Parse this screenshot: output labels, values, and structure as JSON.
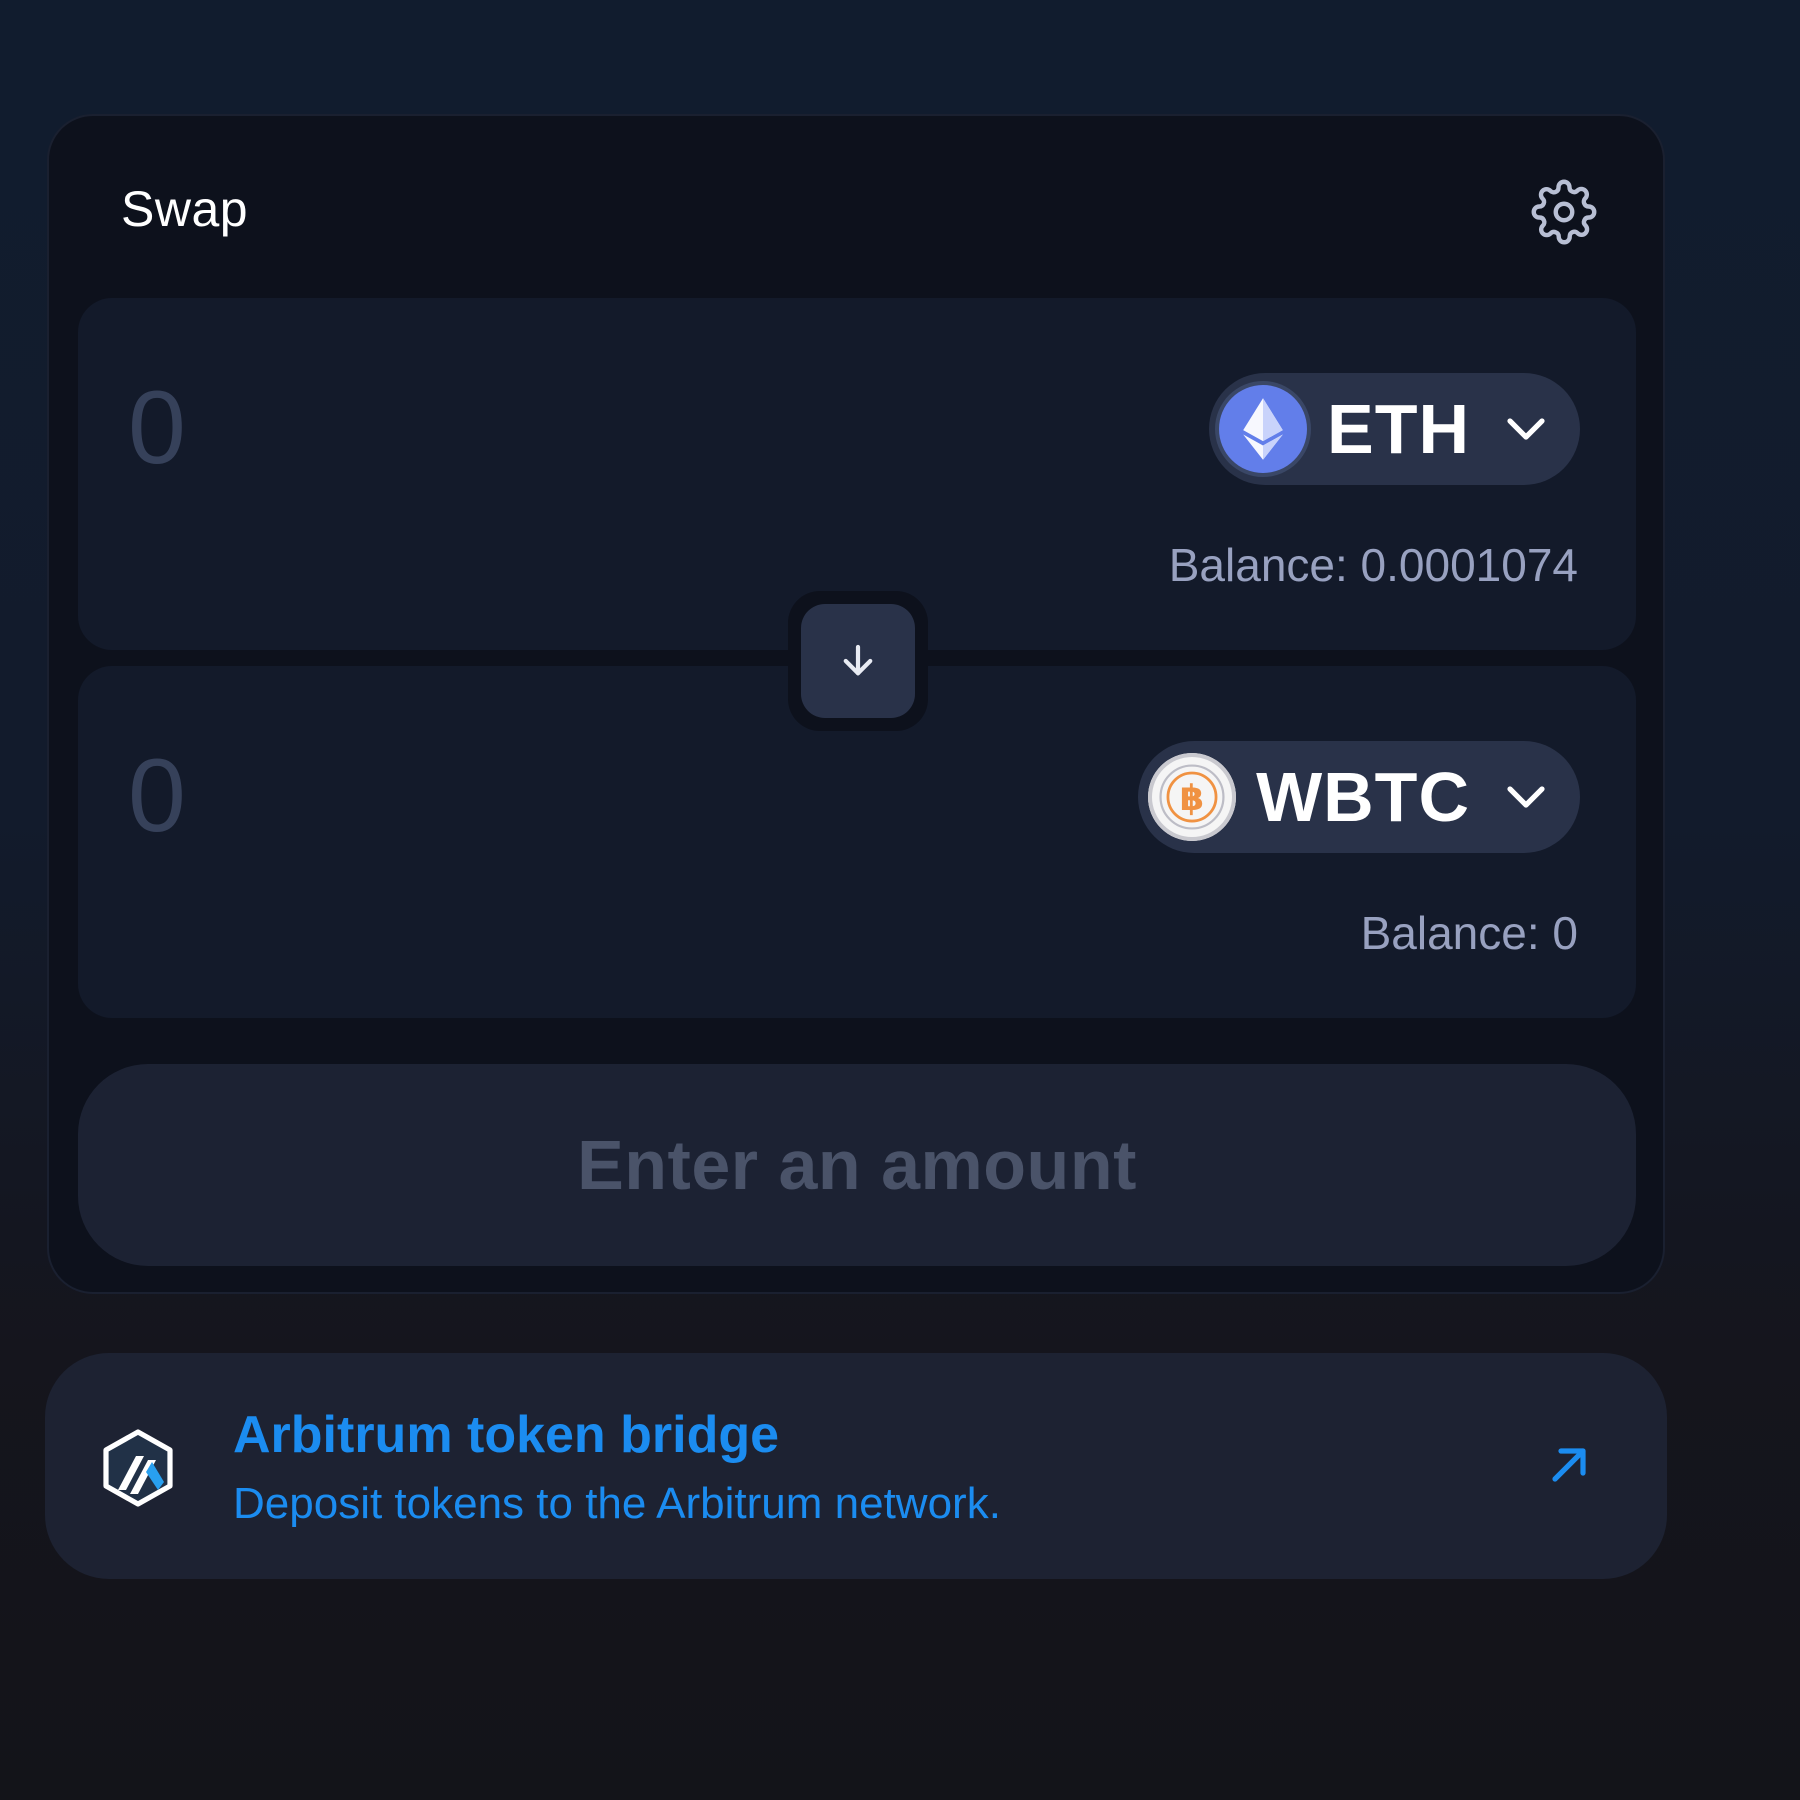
{
  "swap": {
    "title": "Swap",
    "settings_icon": "gear-icon",
    "switch_icon": "arrow-down-icon",
    "from": {
      "amount_placeholder": "0",
      "token_symbol": "ETH",
      "token_icon": "eth-icon",
      "balance": "Balance: 0.0001074"
    },
    "to": {
      "amount_placeholder": "0",
      "token_symbol": "WBTC",
      "token_icon": "wbtc-icon",
      "balance": "Balance: 0"
    },
    "cta_label": "Enter an amount"
  },
  "bridge": {
    "title": "Arbitrum token bridge",
    "subtitle": "Deposit tokens to the Arbitrum network.",
    "logo_icon": "arbitrum-logo-icon",
    "link_icon": "external-arrow-icon"
  },
  "colors": {
    "background": "#111c2e",
    "card": "#0d111c",
    "panel": "#131a2a",
    "token_pill": "#293249",
    "accent": "#1b8cf0",
    "muted_text": "#98a1c0",
    "eth": "#627eea",
    "btc": "#f09242"
  }
}
